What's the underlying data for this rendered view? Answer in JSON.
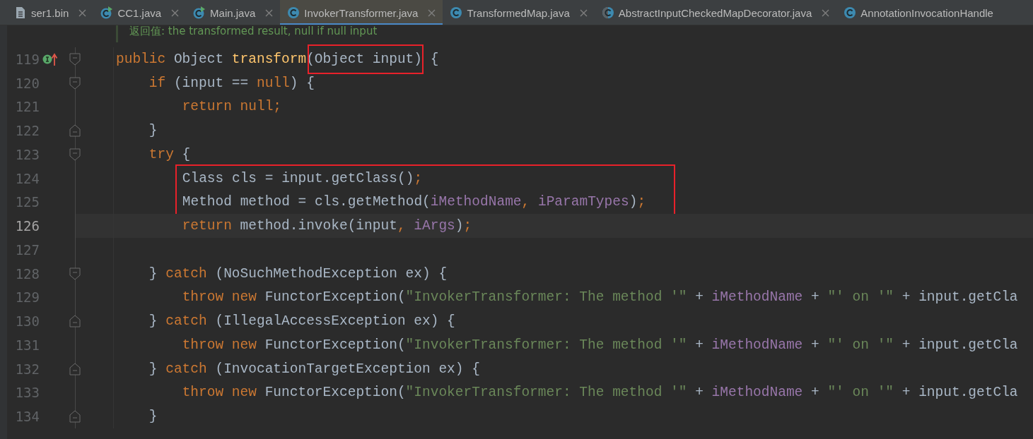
{
  "tabs": [
    {
      "label": "ser1.bin",
      "kind": "file",
      "selected": false,
      "cut": false
    },
    {
      "label": "CC1.java",
      "kind": "runnable",
      "selected": false,
      "cut": false
    },
    {
      "label": "Main.java",
      "kind": "runnable",
      "selected": false,
      "cut": false
    },
    {
      "label": "InvokerTransformer.java",
      "kind": "class",
      "selected": true,
      "cut": false
    },
    {
      "label": "TransformedMap.java",
      "kind": "class",
      "selected": false,
      "cut": false
    },
    {
      "label": "AbstractInputCheckedMapDecorator.java",
      "kind": "abstract",
      "selected": false,
      "cut": false
    },
    {
      "label": "AnnotationInvocationHandle",
      "kind": "class",
      "selected": false,
      "cut": true
    }
  ],
  "doc_comment": "返回值: the transformed result, null if null input",
  "lines": [
    {
      "number": "119",
      "fold_start": true,
      "fold_end": false,
      "implements_marker": true,
      "current": false,
      "boxed": false,
      "tokens": [
        {
          "kind": "keyword",
          "text": "public"
        },
        {
          "kind": "plain",
          "text": " Object "
        },
        {
          "kind": "method",
          "text": "transform"
        },
        {
          "kind": "plain",
          "text": "(Object input)",
          "boxed": true
        },
        {
          "kind": "plain",
          "text": " {"
        }
      ]
    },
    {
      "number": "120",
      "fold_start": true,
      "fold_end": false,
      "implements_marker": false,
      "current": false,
      "boxed": false,
      "tokens": [
        {
          "kind": "keyword",
          "text": "    if"
        },
        {
          "kind": "plain",
          "text": " (input == "
        },
        {
          "kind": "keyword",
          "text": "null"
        },
        {
          "kind": "plain",
          "text": ") {"
        }
      ]
    },
    {
      "number": "121",
      "fold_start": false,
      "fold_end": false,
      "implements_marker": false,
      "current": false,
      "boxed": false,
      "tokens": [
        {
          "kind": "keyword",
          "text": "        return null;"
        }
      ]
    },
    {
      "number": "122",
      "fold_start": false,
      "fold_end": true,
      "implements_marker": false,
      "current": false,
      "boxed": false,
      "tokens": [
        {
          "kind": "plain",
          "text": "    }"
        }
      ]
    },
    {
      "number": "123",
      "fold_start": true,
      "fold_end": false,
      "implements_marker": false,
      "current": false,
      "boxed": false,
      "tokens": [
        {
          "kind": "keyword",
          "text": "    try"
        },
        {
          "kind": "plain",
          "text": " {"
        }
      ]
    },
    {
      "number": "124",
      "fold_start": false,
      "fold_end": false,
      "implements_marker": false,
      "current": false,
      "boxed": true,
      "tokens": [
        {
          "kind": "plain",
          "text": "        Class cls = input.getClass()"
        },
        {
          "kind": "keyword",
          "text": ";"
        }
      ]
    },
    {
      "number": "125",
      "fold_start": false,
      "fold_end": false,
      "implements_marker": false,
      "current": false,
      "boxed": true,
      "tokens": [
        {
          "kind": "plain",
          "text": "        Method method = cls.getMethod("
        },
        {
          "kind": "field",
          "text": "iMethodName"
        },
        {
          "kind": "keyword",
          "text": ", "
        },
        {
          "kind": "field",
          "text": "iParamTypes"
        },
        {
          "kind": "plain",
          "text": ")"
        },
        {
          "kind": "keyword",
          "text": ";"
        }
      ]
    },
    {
      "number": "126",
      "fold_start": false,
      "fold_end": false,
      "implements_marker": false,
      "current": true,
      "boxed": false,
      "tokens": [
        {
          "kind": "keyword",
          "text": "        return "
        },
        {
          "kind": "plain",
          "text": "method.invoke(input"
        },
        {
          "kind": "keyword",
          "text": ", "
        },
        {
          "kind": "field",
          "text": "iArgs"
        },
        {
          "kind": "plain",
          "text": ")"
        },
        {
          "kind": "keyword",
          "text": ";"
        }
      ]
    },
    {
      "number": "127",
      "fold_start": false,
      "fold_end": false,
      "implements_marker": false,
      "current": false,
      "boxed": false
    },
    {
      "number": "128",
      "fold_start": true,
      "fold_end": false,
      "implements_marker": false,
      "current": false,
      "boxed": false,
      "tokens": [
        {
          "kind": "plain",
          "text": "    } "
        },
        {
          "kind": "keyword",
          "text": "catch "
        },
        {
          "kind": "plain",
          "text": "(NoSuchMethodException ex) {"
        }
      ]
    },
    {
      "number": "129",
      "fold_start": false,
      "fold_end": false,
      "implements_marker": false,
      "current": false,
      "boxed": false,
      "tokens": [
        {
          "kind": "keyword",
          "text": "        throw new "
        },
        {
          "kind": "plain",
          "text": "FunctorException("
        },
        {
          "kind": "string",
          "text": "\"InvokerTransformer: The method '\""
        },
        {
          "kind": "plain",
          "text": " + "
        },
        {
          "kind": "field",
          "text": "iMethodName"
        },
        {
          "kind": "plain",
          "text": " + "
        },
        {
          "kind": "string",
          "text": "\"' on '\""
        },
        {
          "kind": "plain",
          "text": " + input.getCla"
        }
      ]
    },
    {
      "number": "130",
      "fold_start": false,
      "fold_end": true,
      "implements_marker": false,
      "current": false,
      "boxed": false,
      "tokens": [
        {
          "kind": "plain",
          "text": "    } "
        },
        {
          "kind": "keyword",
          "text": "catch "
        },
        {
          "kind": "plain",
          "text": "(IllegalAccessException ex) {"
        }
      ]
    },
    {
      "number": "131",
      "fold_start": false,
      "fold_end": false,
      "implements_marker": false,
      "current": false,
      "boxed": false,
      "tokens": [
        {
          "kind": "keyword",
          "text": "        throw new "
        },
        {
          "kind": "plain",
          "text": "FunctorException("
        },
        {
          "kind": "string",
          "text": "\"InvokerTransformer: The method '\""
        },
        {
          "kind": "plain",
          "text": " + "
        },
        {
          "kind": "field",
          "text": "iMethodName"
        },
        {
          "kind": "plain",
          "text": " + "
        },
        {
          "kind": "string",
          "text": "\"' on '\""
        },
        {
          "kind": "plain",
          "text": " + input.getCla"
        }
      ]
    },
    {
      "number": "132",
      "fold_start": false,
      "fold_end": true,
      "implements_marker": false,
      "current": false,
      "boxed": false,
      "tokens": [
        {
          "kind": "plain",
          "text": "    } "
        },
        {
          "kind": "keyword",
          "text": "catch "
        },
        {
          "kind": "plain",
          "text": "(InvocationTargetException ex) {"
        }
      ]
    },
    {
      "number": "133",
      "fold_start": false,
      "fold_end": false,
      "implements_marker": false,
      "current": false,
      "boxed": false,
      "tokens": [
        {
          "kind": "keyword",
          "text": "        throw new "
        },
        {
          "kind": "plain",
          "text": "FunctorException("
        },
        {
          "kind": "string",
          "text": "\"InvokerTransformer: The method '\""
        },
        {
          "kind": "plain",
          "text": " + "
        },
        {
          "kind": "field",
          "text": "iMethodName"
        },
        {
          "kind": "plain",
          "text": " + "
        },
        {
          "kind": "string",
          "text": "\"' on '\""
        },
        {
          "kind": "plain",
          "text": " + input.getCla"
        }
      ]
    },
    {
      "number": "134",
      "fold_start": false,
      "fold_end": true,
      "implements_marker": false,
      "current": false,
      "boxed": false,
      "tokens": [
        {
          "kind": "plain",
          "text": "    }"
        }
      ]
    }
  ]
}
